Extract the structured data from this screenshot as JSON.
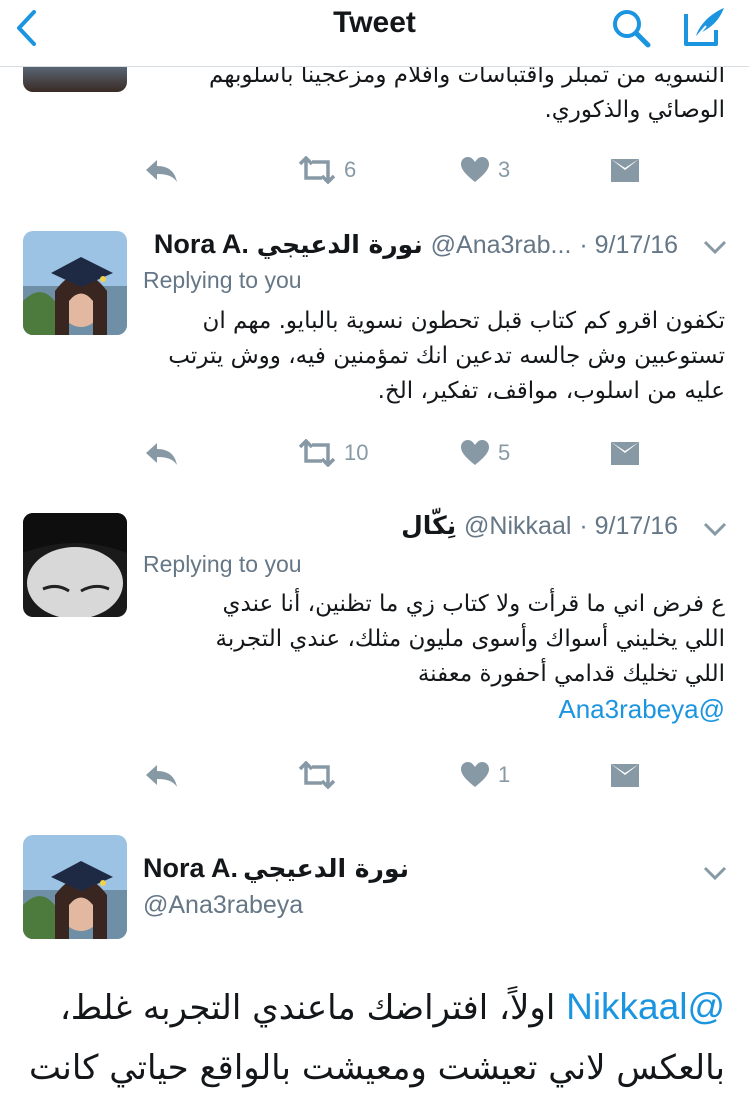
{
  "nav": {
    "title": "Tweet"
  },
  "tweets": [
    {
      "body_lines": [
        "النسويه من تمبلر واقتباسات وافلام ومزعجينا باسلوبهم",
        "الوصائي والذكوري."
      ],
      "retweets": "6",
      "likes": "3"
    },
    {
      "name_en": "Nora A.",
      "name_ar": "نورة الدعيجي",
      "handle": "@Ana3rab...",
      "date": "· 9/17/16",
      "replying": "Replying to you",
      "body_lines": [
        "تكفون اقرو كم كتاب قبل تحطون نسوية بالبايو. مهم ان",
        "تستوعبين وش جالسه تدعين انك تمؤمنين فيه، ووش يترتب",
        "عليه من اسلوب، مواقف، تفكير، الخ."
      ],
      "retweets": "10",
      "likes": "5"
    },
    {
      "name_ar": "نِكّال",
      "handle": "@Nikkaal",
      "date": "· 9/17/16",
      "replying": "Replying to you",
      "body_lines": [
        "ع فرض اني ما قرأت ولا كتاب زي ما تظنين، أنا عندي",
        "اللي يخليني أسواك وأسوى مليون مثلك، عندي التجربة",
        "اللي تخليك قدامي أحفورة معفنة"
      ],
      "mention": "@Ana3rabeya",
      "retweets": "",
      "likes": "1"
    },
    {
      "name_en": "Nora A.",
      "name_ar": "نورة الدعيجي",
      "handle": "@Ana3rabeya",
      "big_mention": "@Nikkaal",
      "big_line1": "اولاً، افتراضك ماعندي التجربه غلط،",
      "big_line2": "بالعكس لاني تعيشت ومعيشت بالواقع حياتي كانت"
    }
  ]
}
